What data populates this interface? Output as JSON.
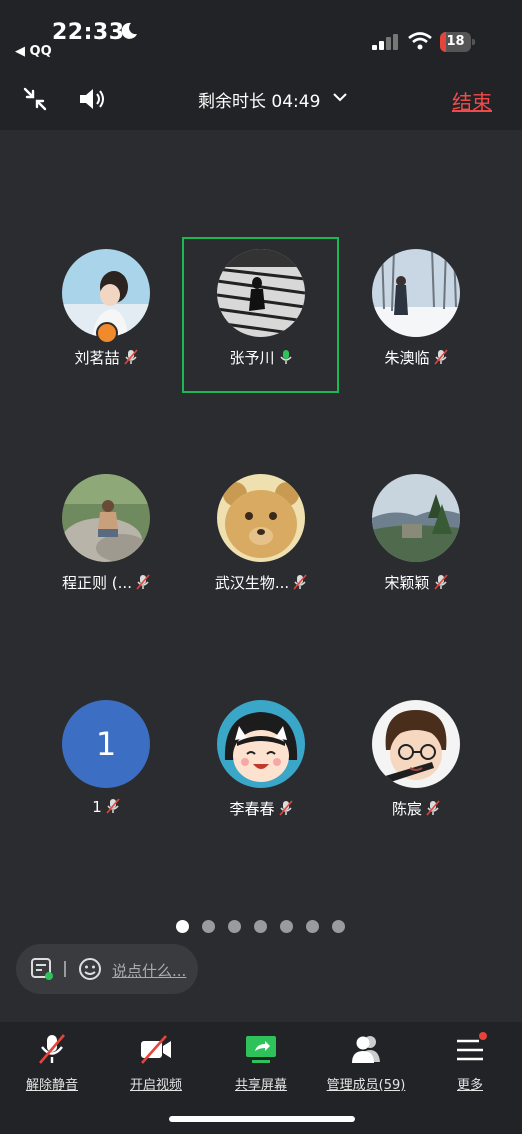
{
  "status_bar": {
    "time": "22:33",
    "back_app": "◀ QQ",
    "battery": "18",
    "battery_level_percent": 18
  },
  "header": {
    "timer_label": "剩余时长 04:49",
    "end_label": "结束",
    "icons": [
      "shrink-icon",
      "speaker-icon",
      "chevron-down-icon"
    ]
  },
  "colors": {
    "background": "#2b2c2f",
    "bar": "#222326",
    "end_red": "#f04a4a",
    "active_green": "#19b955"
  },
  "participants": [
    {
      "name": "刘茗喆",
      "mic": "muted",
      "avatar": "photo-girl",
      "host": true
    },
    {
      "name": "张予川",
      "mic": "speaking",
      "avatar": "photo-bw-steps",
      "active": true
    },
    {
      "name": "朱澳临",
      "mic": "muted",
      "avatar": "photo-snow"
    },
    {
      "name": "程正则 (...",
      "mic": "muted",
      "avatar": "photo-rocks"
    },
    {
      "name": "武汉生物...",
      "mic": "muted",
      "avatar": "bear-cartoon"
    },
    {
      "name": "宋颖颖",
      "mic": "muted",
      "avatar": "photo-landscape"
    },
    {
      "name": "1",
      "mic": "muted",
      "avatar": "initial",
      "initial": "1"
    },
    {
      "name": "李春春",
      "mic": "muted",
      "avatar": "maruko-cartoon"
    },
    {
      "name": "陈宸",
      "mic": "muted",
      "avatar": "harry-cartoon"
    }
  ],
  "pagination": {
    "pages": 7,
    "current": 1
  },
  "chat": {
    "placeholder": "说点什么..."
  },
  "toolbar": {
    "unmute": "解除静音",
    "video": "开启视频",
    "share": "共享屏幕",
    "members": "管理成员(59)",
    "more": "更多"
  }
}
